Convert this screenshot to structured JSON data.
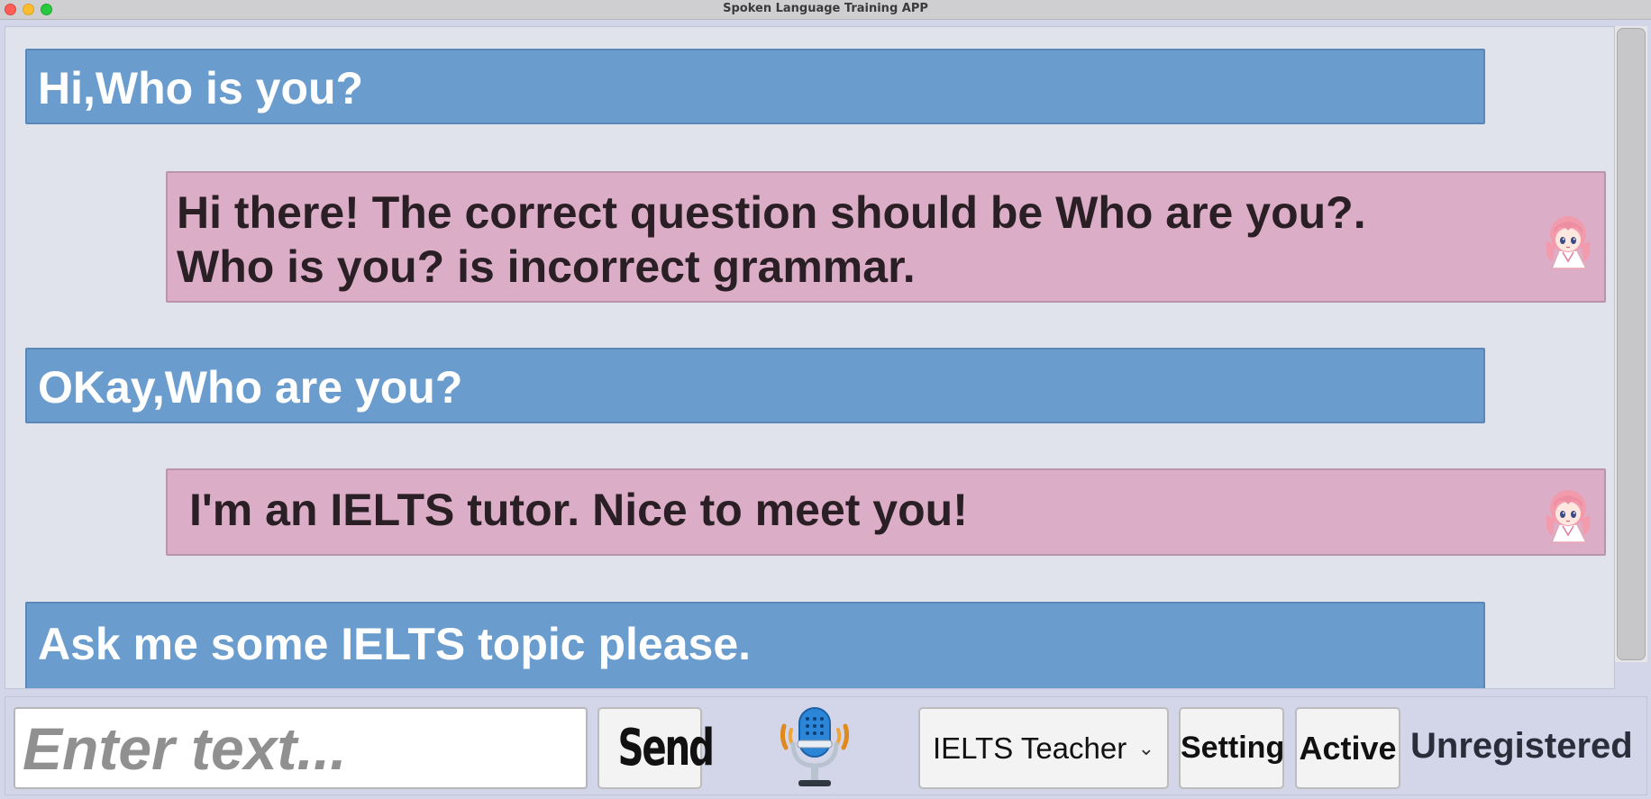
{
  "window": {
    "title": "Spoken Language Training APP"
  },
  "messages": [
    {
      "role": "user",
      "text": "Hi,Who is you?"
    },
    {
      "role": "bot",
      "text": " Hi there! The correct question should be Who are you?.\nWho is you? is incorrect grammar."
    },
    {
      "role": "user",
      "text": "OKay,Who are you?"
    },
    {
      "role": "bot",
      "text": "I'm an IELTS tutor. Nice to meet you!"
    },
    {
      "role": "user",
      "text": "Ask me some IELTS topic please."
    }
  ],
  "input": {
    "placeholder": "Enter text...",
    "value": ""
  },
  "controls": {
    "send_label": "Send",
    "role_selected": "IELTS Teacher",
    "setting_label": "Setting",
    "active_label": "Active",
    "status": "Unregistered"
  },
  "icons": {
    "mic": "microphone-icon",
    "avatar": "anime-girl-avatar-icon",
    "chevron": "chevron-down-icon"
  },
  "colors": {
    "user_bubble": "#6a9cce",
    "bot_bubble": "#dbadc6",
    "chat_bg": "#e0e3ec",
    "bar_bg": "#d3d6e8"
  }
}
